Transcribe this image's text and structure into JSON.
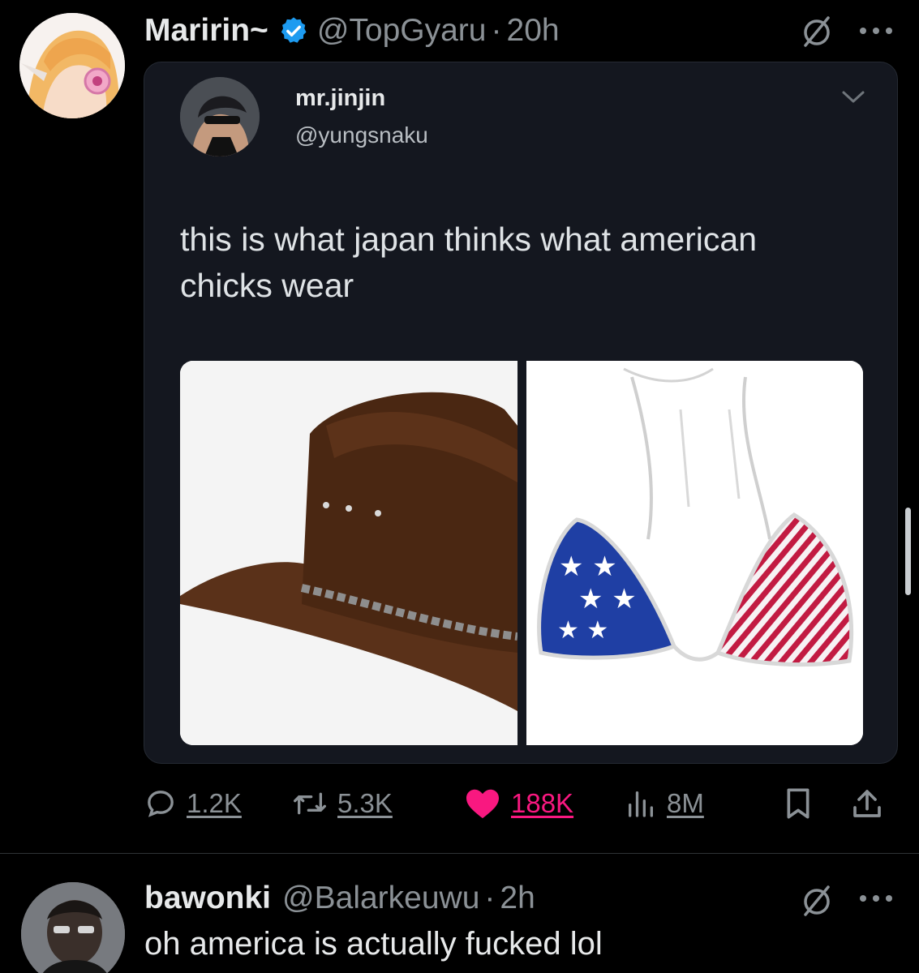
{
  "main_tweet": {
    "display_name": "Maririn~",
    "handle": "@TopGyaru",
    "separator": "·",
    "time": "20h",
    "avatar_icon": "anime-girl-avatar",
    "verified_color": "#1d9bf0"
  },
  "quoted_tweet": {
    "display_name": "mr.jinjin",
    "handle": "@yungsnaku",
    "text": "this is what japan thinks what american chicks wear",
    "images": [
      "cowboy-hat-photo",
      "flag-bikini-top-photo"
    ]
  },
  "actions": {
    "replies": "1.2K",
    "reposts": "5.3K",
    "likes": "188K",
    "views": "8M",
    "like_color": "#f91880"
  },
  "reply_tweet": {
    "display_name": "bawonki",
    "handle": "@Balarkeuwu",
    "separator": "·",
    "time": "2h",
    "text": "oh america is actually fucked lol"
  }
}
